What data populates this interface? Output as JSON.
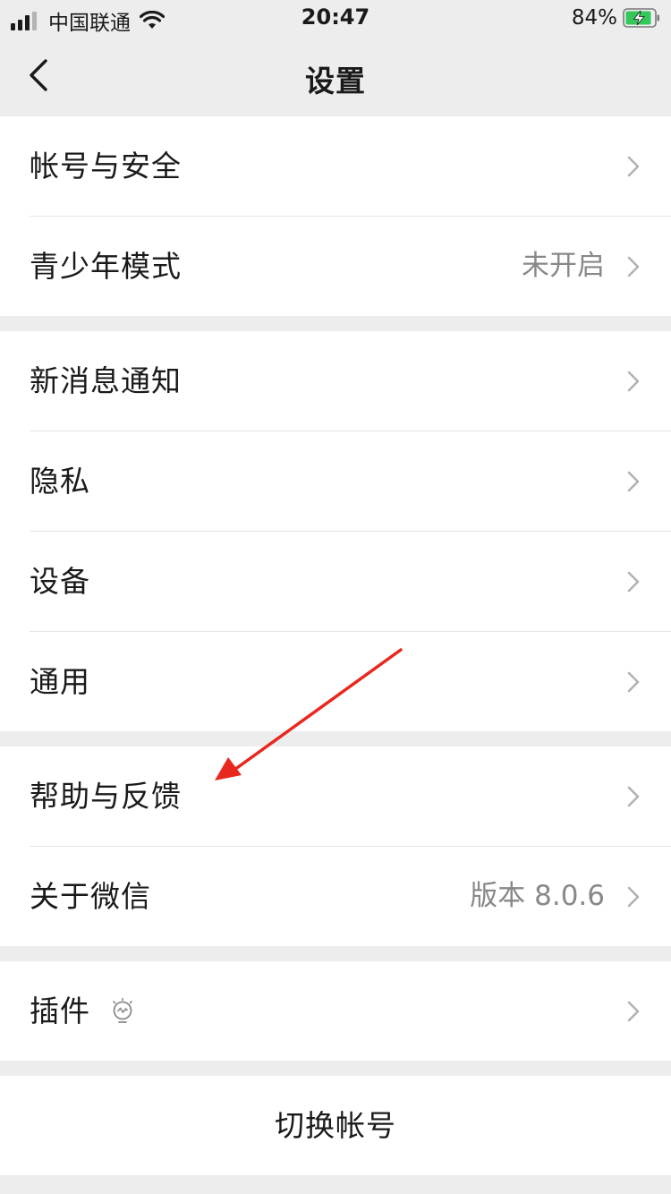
{
  "status_bar": {
    "carrier": "中国联通",
    "time": "20:47",
    "battery": "84%",
    "icons": [
      "signal-icon",
      "wifi-icon",
      "battery-charging-icon"
    ]
  },
  "nav": {
    "title": "设置",
    "back_icon": "chevron-left-icon"
  },
  "groups": [
    {
      "items": [
        {
          "label": "帐号与安全",
          "value": ""
        },
        {
          "label": "青少年模式",
          "value": "未开启"
        }
      ]
    },
    {
      "items": [
        {
          "label": "新消息通知",
          "value": ""
        },
        {
          "label": "隐私",
          "value": ""
        },
        {
          "label": "设备",
          "value": ""
        },
        {
          "label": "通用",
          "value": ""
        }
      ]
    },
    {
      "items": [
        {
          "label": "帮助与反馈",
          "value": ""
        },
        {
          "label": "关于微信",
          "value": "版本 8.0.6"
        }
      ]
    },
    {
      "items": [
        {
          "label": "插件",
          "value": "",
          "icon": "plugin-bulb-icon"
        }
      ]
    }
  ],
  "switch_account": "切换帐号",
  "annotation": {
    "arrow_color": "#e8281f",
    "arrow_points_to": "帮助与反馈"
  }
}
